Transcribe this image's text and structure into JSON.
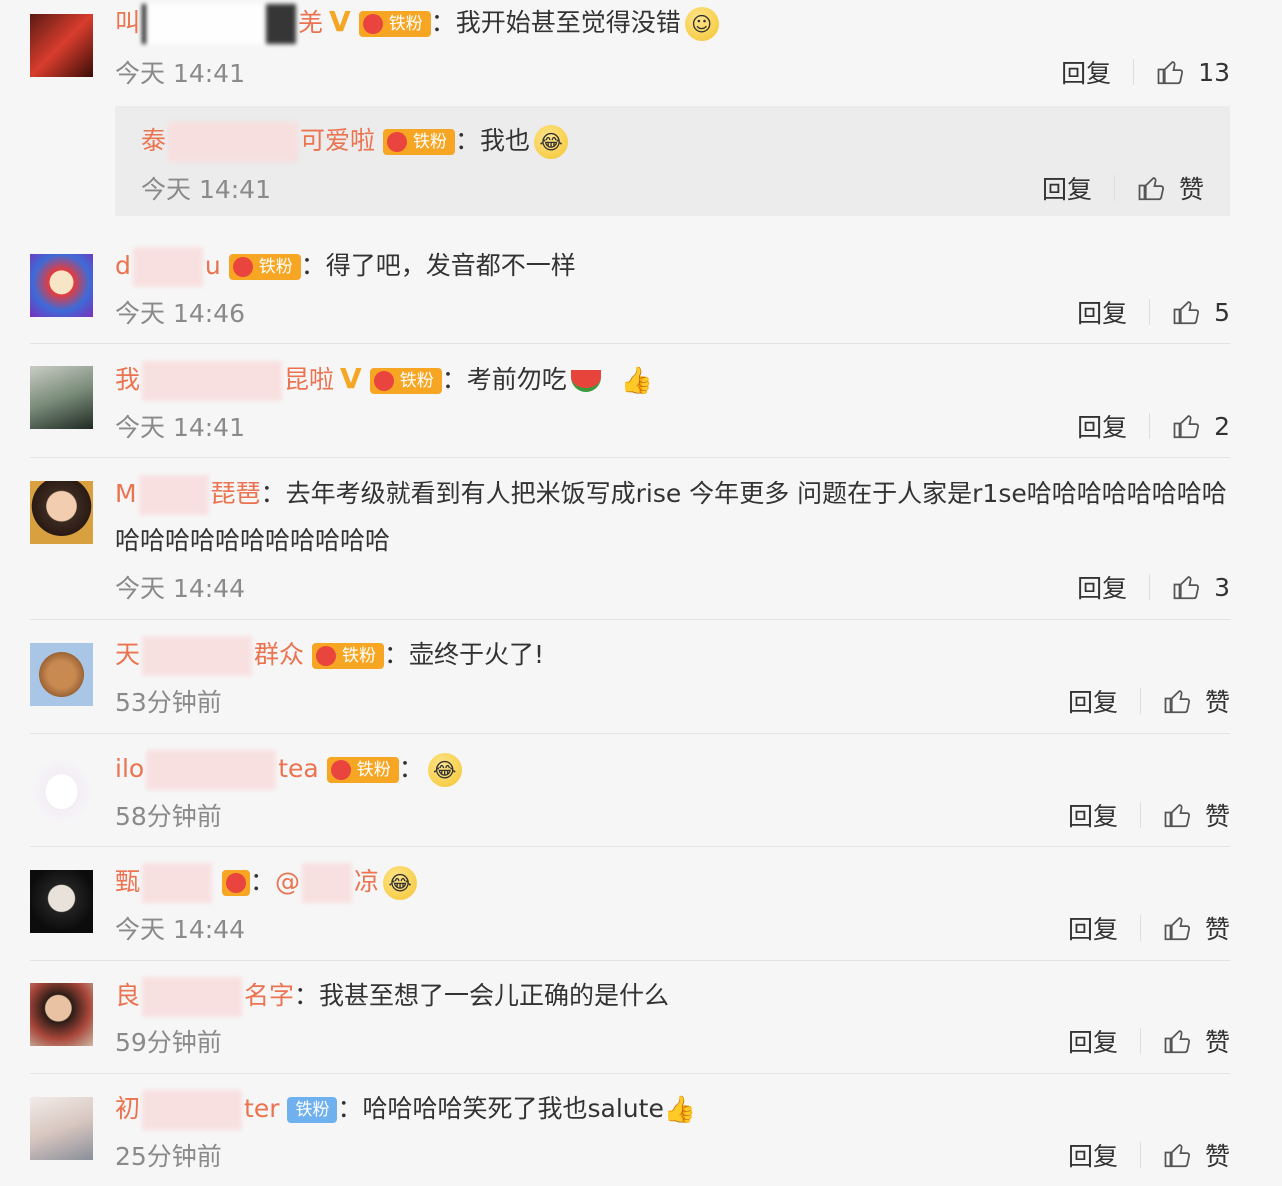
{
  "fan_badge": "铁粉",
  "reply_label": "回复",
  "like_label": "赞",
  "comments": [
    {
      "name_pre": "叫",
      "name_post": "羌",
      "vip": "V",
      "text": "我开始甚至觉得没错",
      "emoji": "emoji-face",
      "time": "今天 14:41",
      "likes": "13"
    },
    {
      "name_pre": "泰",
      "name_post": "可爱啦",
      "text": "我也",
      "emoji": "emoji-laugh-cry",
      "time": "今天 14:41",
      "likes": "赞"
    },
    {
      "name_pre": "d",
      "name_post": "u",
      "text": "得了吧，发音都不一样",
      "time": "今天 14:46",
      "likes": "5"
    },
    {
      "name_pre": "我",
      "name_post": "昆啦",
      "vip": "V",
      "text": "考前勿吃",
      "emoji": "watermelon-icon",
      "time": "今天 14:41",
      "likes": "2"
    },
    {
      "name_pre": "M",
      "name_post": "琵琶",
      "text": "去年考级就看到有人把米饭写成rise 今年更多 问题在于人家是r1se哈哈哈哈哈哈哈哈",
      "text2": "哈哈哈哈哈哈哈哈哈哈哈",
      "time": "今天 14:44",
      "likes": "3"
    },
    {
      "name_pre": "天",
      "name_post": "群众",
      "text": "壶终于火了!",
      "time": "53分钟前",
      "likes": "赞"
    },
    {
      "name_pre": "ilo",
      "name_post": "tea",
      "text": "",
      "emoji": "emoji-laugh-cry",
      "time": "58分钟前",
      "likes": "赞"
    },
    {
      "name_pre": "甄",
      "name_post": "",
      "text": "@",
      "text_post": "凉",
      "emoji": "emoji-laugh-cry",
      "time": "今天 14:44",
      "likes": "赞"
    },
    {
      "name_pre": "良",
      "name_post": "名字",
      "text": "我甚至想了一会儿正确的是什么",
      "time": "59分钟前",
      "likes": "赞"
    },
    {
      "name_pre": "初",
      "name_post": "ter",
      "text": "哈哈哈哈笑死了我也salute",
      "time": "25分钟前",
      "likes": "赞"
    }
  ]
}
